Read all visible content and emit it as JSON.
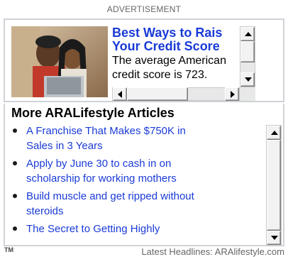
{
  "ad": {
    "label": "ADVERTISEMENT",
    "headline_line1": "Best Ways to Rais",
    "headline_line2": "Your Credit Score",
    "body_line1": "The average American",
    "body_line2": "credit score is 723.",
    "photo_icon": "couple-with-laptop-photo"
  },
  "articles": {
    "title": "More ARALifestyle Articles",
    "items": [
      {
        "line1": "A Franchise That Makes $750K in",
        "line2": "Sales in 3 Years"
      },
      {
        "line1": "Apply by June 30 to cash in on",
        "line2": "scholarship for working mothers"
      },
      {
        "line1": "Build muscle and get ripped without",
        "line2": "steroids"
      },
      {
        "line1": "The Secret to Getting Highly",
        "line2": ""
      }
    ]
  },
  "footer": {
    "tm": "TM",
    "link": "Latest Headlines: ARAlifestyle.com"
  },
  "colors": {
    "link": "#1a3bd6",
    "border": "#cfd3d8",
    "muted": "#666666"
  }
}
